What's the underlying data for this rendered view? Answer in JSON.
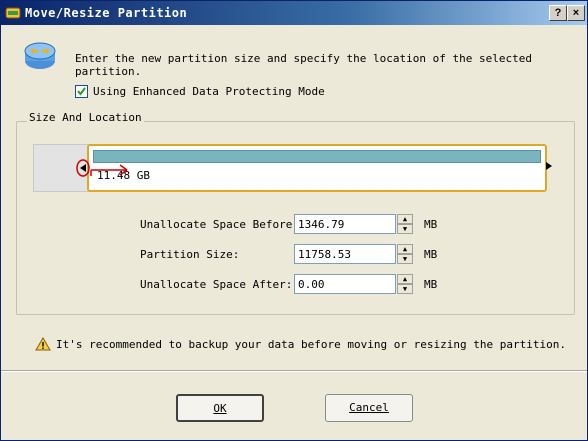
{
  "window": {
    "title": "Move/Resize Partition",
    "help_label": "?",
    "close_label": "×"
  },
  "intro": "Enter the new partition size and specify the location of the selected partition.",
  "checkbox": {
    "label": "Using Enhanced Data Protecting Mode",
    "checked": true
  },
  "group": {
    "label": "Size And Location"
  },
  "partition": {
    "size_label": "11.48 GB"
  },
  "fields": [
    {
      "label": "Unallocate Space Before:",
      "value": "1346.79",
      "unit": "MB"
    },
    {
      "label": "Partition Size:",
      "value": "11758.53",
      "unit": "MB"
    },
    {
      "label": "Unallocate Space After:",
      "value": "0.00",
      "unit": "MB"
    }
  ],
  "warning": "It's recommended to backup your data before moving or resizing the partition.",
  "buttons": {
    "ok": "OK",
    "cancel": "Cancel"
  },
  "colors": {
    "title_bar": "#0a246a",
    "partition_border": "#e0a828",
    "partition_fill": "#7ab4be",
    "highlight": "#cc0000"
  },
  "icons": {
    "title": "partition-app-icon",
    "header": "resize-partition-icon",
    "warning": "warning-icon"
  }
}
